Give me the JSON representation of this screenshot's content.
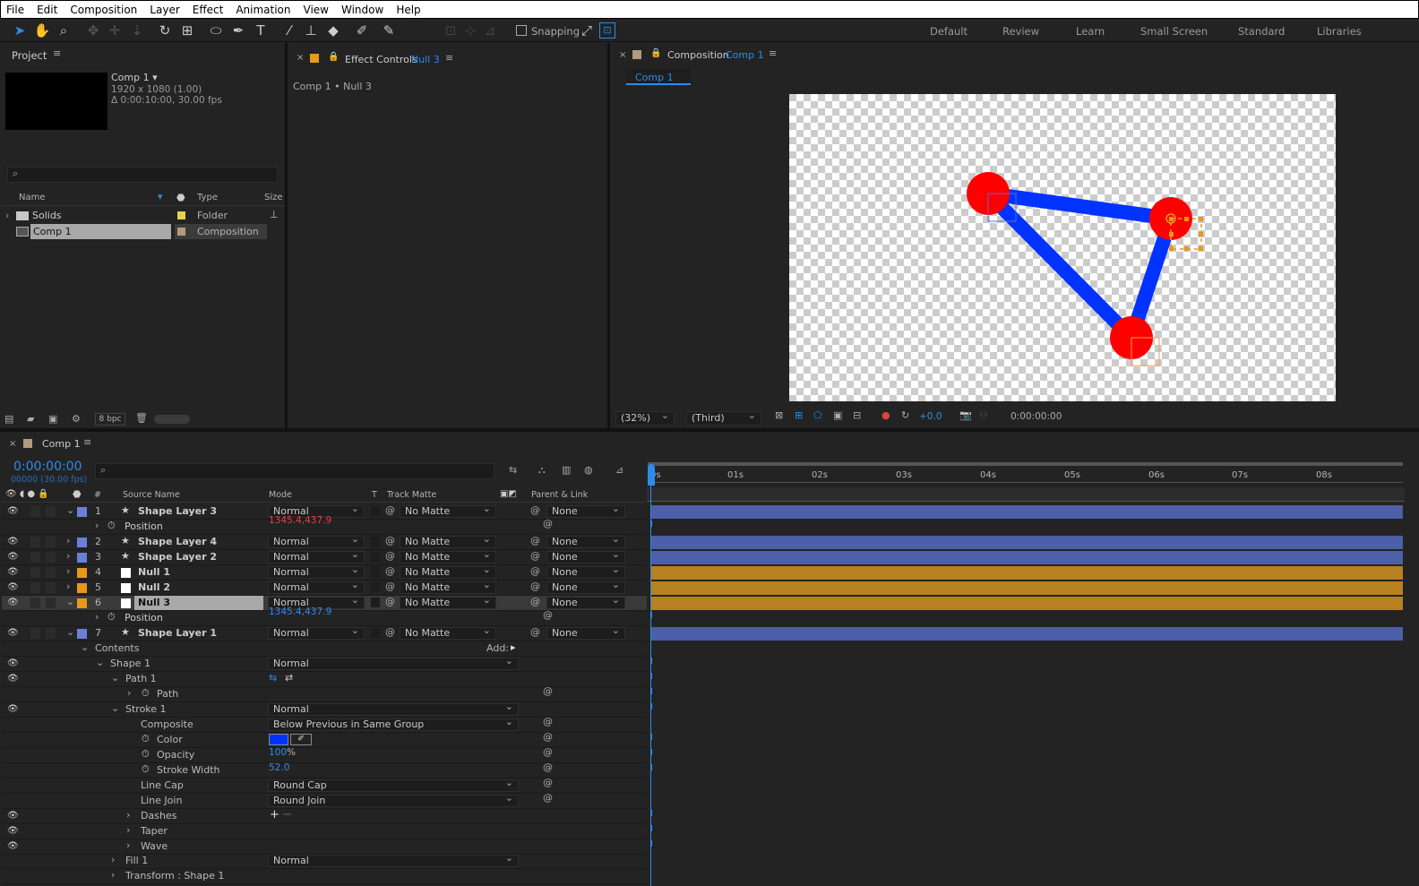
{
  "menu": [
    "File",
    "Edit",
    "Composition",
    "Layer",
    "Effect",
    "Animation",
    "View",
    "Window",
    "Help"
  ],
  "toolbar": {
    "snapping": "Snapping",
    "workspaces": [
      "Default",
      "Review",
      "Learn",
      "Small Screen",
      "Standard",
      "Libraries"
    ]
  },
  "project": {
    "title": "Project",
    "comp_name": "Comp 1 ▾",
    "comp_dims": "1920 x 1080 (1.00)",
    "comp_dur": "Δ 0:00:10:00, 30.00 fps",
    "col_name": "Name",
    "col_type": "Type",
    "col_size": "Size",
    "items": [
      {
        "name": "Solids",
        "type": "Folder",
        "color": "#e3d24a"
      },
      {
        "name": "Comp 1",
        "type": "Composition",
        "color": "#b39a7d"
      }
    ],
    "bpc": "8 bpc"
  },
  "effect_controls": {
    "title": "Effect Controls",
    "layer": "Null 3",
    "breadcrumb": "Comp 1 • Null 3"
  },
  "composition": {
    "title": "Composition",
    "comp": "Comp 1",
    "tab": "Comp 1",
    "zoom": "(32%)",
    "view": "(Third)",
    "exposure": "+0.0",
    "time": "0:00:00:00"
  },
  "timeline": {
    "tab": "Comp 1",
    "timecode": "0:00:00:00",
    "frames": "00000 (30.00 fps)",
    "headers": {
      "num": "#",
      "source": "Source Name",
      "mode": "Mode",
      "t": "T",
      "matte": "Track Matte",
      "parent": "Parent & Link"
    },
    "ruler": [
      "0s",
      "01s",
      "02s",
      "03s",
      "04s",
      "05s",
      "06s",
      "07s",
      "08s"
    ],
    "add_label": "Add:",
    "rows": [
      {
        "num": "1",
        "name": "Shape Layer 3",
        "mode": "Normal",
        "matte": "No Matte",
        "parent": "None",
        "label": "#6b7fd8"
      },
      {
        "prop": "Position",
        "value": "1345.4,437.9",
        "red": true
      },
      {
        "num": "2",
        "name": "Shape Layer 4",
        "mode": "Normal",
        "matte": "No Matte",
        "parent": "None",
        "label": "#6b7fd8"
      },
      {
        "num": "3",
        "name": "Shape Layer 2",
        "mode": "Normal",
        "matte": "No Matte",
        "parent": "None",
        "label": "#6b7fd8"
      },
      {
        "num": "4",
        "name": "Null 1",
        "mode": "Normal",
        "matte": "No Matte",
        "parent": "None",
        "label": "#e8981a"
      },
      {
        "num": "5",
        "name": "Null 2",
        "mode": "Normal",
        "matte": "No Matte",
        "parent": "None",
        "label": "#e8981a"
      },
      {
        "num": "6",
        "name": "Null 3",
        "mode": "Normal",
        "matte": "No Matte",
        "parent": "None",
        "label": "#e8981a"
      },
      {
        "prop": "Position",
        "value": "1345.4,437.9"
      },
      {
        "num": "7",
        "name": "Shape Layer 1",
        "mode": "Normal",
        "matte": "No Matte",
        "parent": "None",
        "label": "#6b7fd8"
      }
    ],
    "contents": "Contents",
    "shape1": "Shape 1",
    "shape1_mode": "Normal",
    "path1": "Path 1",
    "path": "Path",
    "stroke1": "Stroke 1",
    "stroke1_mode": "Normal",
    "composite": "Composite",
    "composite_val": "Below Previous in Same Group",
    "color": "Color",
    "opacity": "Opacity",
    "opacity_val": "100",
    "opacity_unit": "%",
    "stroke_width": "Stroke Width",
    "stroke_width_val": "52.0",
    "line_cap": "Line Cap",
    "line_cap_val": "Round Cap",
    "line_join": "Line Join",
    "line_join_val": "Round Join",
    "dashes": "Dashes",
    "taper": "Taper",
    "wave": "Wave",
    "fill1": "Fill 1",
    "fill1_mode": "Normal",
    "transform": "Transform : Shape 1",
    "stroke_color": "#0033ff"
  }
}
